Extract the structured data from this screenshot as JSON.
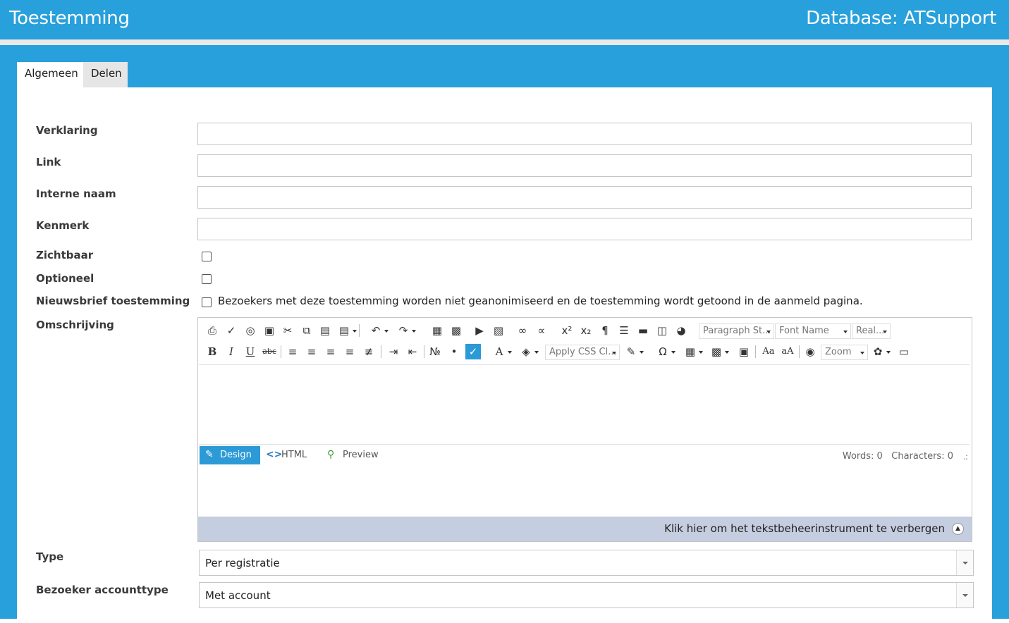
{
  "header": {
    "title": "Toestemming",
    "database": "Database: ATSupport"
  },
  "tabs": [
    {
      "label": "Algemeen"
    },
    {
      "label": "Delen"
    }
  ],
  "form": {
    "verklaring_label": "Verklaring",
    "link_label": "Link",
    "interne_naam_label": "Interne naam",
    "kenmerk_label": "Kenmerk",
    "zichtbaar_label": "Zichtbaar",
    "optioneel_label": "Optioneel",
    "nieuwsbrief_label": "Nieuwsbrief toestemming",
    "nieuwsbrief_text": "Bezoekers met deze toestemming worden niet geanonimiseerd en de toestemming wordt getoond in de aanmeld pagina.",
    "omschrijving_label": "Omschrijving",
    "type_label": "Type",
    "type_value": "Per registratie",
    "accounttype_label": "Bezoeker accounttype",
    "accounttype_value": "Met account"
  },
  "editor": {
    "paragraph_style": "Paragraph St...",
    "font_name": "Font Name",
    "font_size": "Real...",
    "apply_css": "Apply CSS Cl...",
    "zoom": "Zoom",
    "modes": [
      "Design",
      "HTML",
      "Preview"
    ],
    "words": "Words: 0",
    "characters": "Characters: 0",
    "hide_toolbar": "Klik hier om het tekstbeheerinstrument te verbergen"
  }
}
